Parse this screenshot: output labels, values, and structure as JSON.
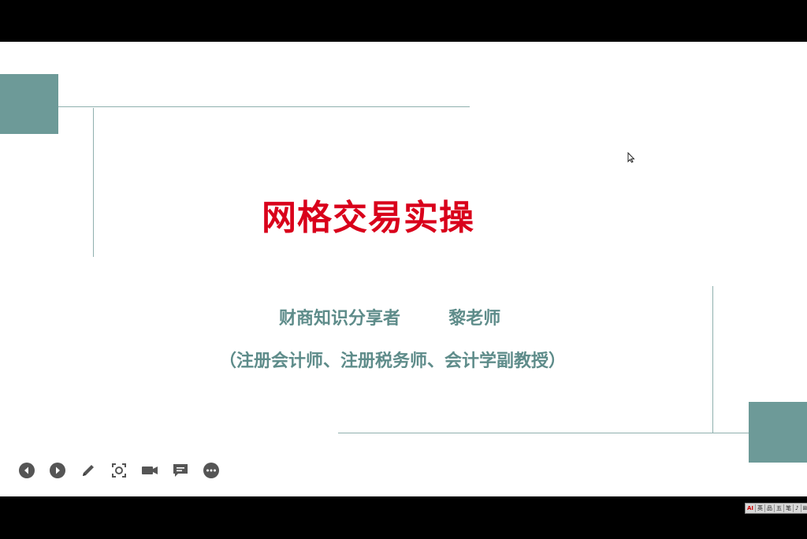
{
  "slide": {
    "title": "网格交易实操",
    "subtitle": "财商知识分享者        黎老师",
    "credentials": "（注册会计师、注册税务师、会计学副教授）"
  },
  "colors": {
    "title": "#d9001b",
    "accent": "#6d9a98",
    "subtitle": "#5e8c8a",
    "letterbox": "#000000"
  },
  "toolbar": {
    "buttons": [
      {
        "name": "previous-slide-button",
        "icon": "chevron-left-circle-icon"
      },
      {
        "name": "next-slide-button",
        "icon": "chevron-right-circle-icon"
      },
      {
        "name": "pen-tool-button",
        "icon": "pencil-icon"
      },
      {
        "name": "zoom-button",
        "icon": "zoom-target-icon"
      },
      {
        "name": "camera-button",
        "icon": "video-camera-icon"
      },
      {
        "name": "subtitles-button",
        "icon": "comment-icon"
      },
      {
        "name": "more-options-button",
        "icon": "more-dots-icon"
      }
    ]
  },
  "taskbar_tray": {
    "items": [
      "AI",
      "英",
      "品",
      "五",
      "笔",
      "♪",
      "⊞",
      "▦"
    ]
  }
}
